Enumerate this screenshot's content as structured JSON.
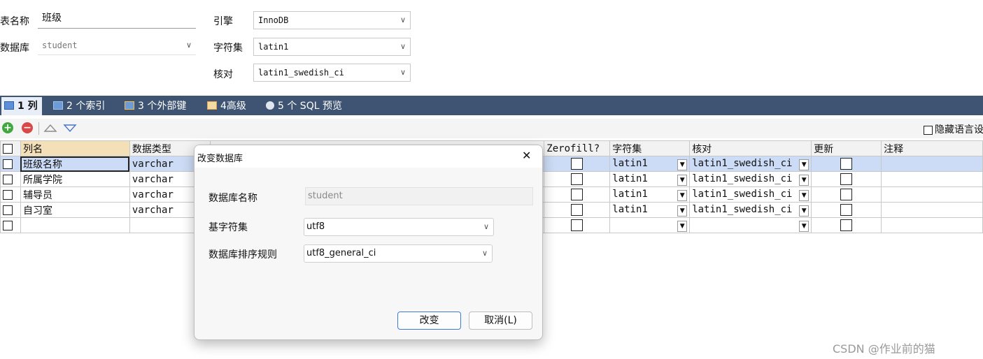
{
  "form": {
    "table_name_label": "表名称",
    "table_name_value": "班级",
    "database_label": "数据库",
    "database_value": "student",
    "engine_label": "引擎",
    "engine_value": "InnoDB",
    "charset_label": "字符集",
    "charset_value": "latin1",
    "collation_label": "核对",
    "collation_value": "latin1_swedish_ci"
  },
  "tabs": [
    "1 列",
    "2 个索引",
    "3 个外部键",
    "4高级",
    "5 个 SQL 预览"
  ],
  "toolbar": {
    "hide_language_label": "隐藏语言设"
  },
  "grid": {
    "headers": {
      "name": "列名",
      "type": "数据类型",
      "zerofill": "Zerofill?",
      "charset": "字符集",
      "collation": "核对",
      "update": "更新",
      "comment": "注释"
    },
    "rows": [
      {
        "name": "班级名称",
        "type": "varchar",
        "charset": "latin1",
        "collation": "latin1_swedish_ci"
      },
      {
        "name": "所属学院",
        "type": "varchar",
        "charset": "latin1",
        "collation": "latin1_swedish_ci"
      },
      {
        "name": "辅导员",
        "type": "varchar",
        "charset": "latin1",
        "collation": "latin1_swedish_ci"
      },
      {
        "name": "自习室",
        "type": "varchar",
        "charset": "latin1",
        "collation": "latin1_swedish_ci"
      },
      {
        "name": "",
        "type": "",
        "charset": "",
        "collation": ""
      }
    ]
  },
  "dialog": {
    "title": "改变数据库",
    "close_glyph": "✕",
    "db_name_label": "数据库名称",
    "db_name_value": "student",
    "charset_label": "基字符集",
    "charset_value": "utf8",
    "collation_label": "数据库排序规则",
    "collation_value": "utf8_general_ci",
    "ok_label": "改变",
    "cancel_label": "取消(L)"
  },
  "watermark": "CSDN @作业前的猫",
  "colors": {
    "tabbar": "#3f5472",
    "selected_row": "#cddcf6",
    "accent_button": "#3d7bd6"
  }
}
